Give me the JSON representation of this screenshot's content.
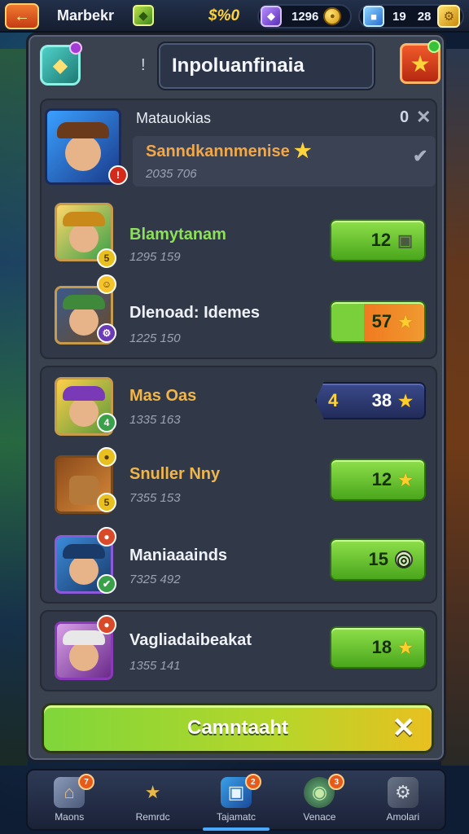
{
  "topbar": {
    "back_icon": "back-arrow-icon",
    "title": "Marbekr",
    "coins": "$%0",
    "gem_count": "1296",
    "cube_count": "19",
    "cube_count2": "28"
  },
  "panel": {
    "title": "Inpoluanfinaia",
    "separator": "!"
  },
  "featured": {
    "header": "Matauokias",
    "header_count": "0",
    "name": "Sanndkannmenise",
    "sub": "2035 706"
  },
  "list": [
    {
      "name": "Blamytanam",
      "sub": "1295 159",
      "value": "12",
      "icon": "chest-icon",
      "name_color": "#8de05a",
      "badge": "5"
    },
    {
      "name": "Dlenoad: Idemes",
      "sub": "1225 150",
      "value": "57",
      "icon": "star-icon",
      "name_color": "#eef1f6",
      "badge": ""
    },
    {
      "name": "Mas Oas",
      "sub": "1335 163",
      "value": "38",
      "icon": "star-icon",
      "name_color": "#f0b64a",
      "badge": "4",
      "prefix": "4"
    },
    {
      "name": "Snuller Nny",
      "sub": "7355 153",
      "value": "12",
      "icon": "star-icon",
      "name_color": "#f0b64a",
      "badge": "5"
    },
    {
      "name": "Maniaaainds",
      "sub": "7325 492",
      "value": "15",
      "icon": "coin-icon",
      "name_color": "#eef1f6",
      "badge": ""
    },
    {
      "name": "Vagliadaibeakat",
      "sub": "1355 141",
      "value": "18",
      "icon": "star-icon",
      "name_color": "#eef1f6",
      "badge": ""
    }
  ],
  "cta": {
    "label": "Camntaaht",
    "close_glyph": "✕"
  },
  "bottomnav": [
    {
      "label": "Maons",
      "icon": "home-icon",
      "glyph": "⌂",
      "badge": "7"
    },
    {
      "label": "Remrdc",
      "icon": "star-icon",
      "glyph": "★",
      "badge": ""
    },
    {
      "label": "Tajamatc",
      "icon": "cards-icon",
      "glyph": "▣",
      "badge": "2"
    },
    {
      "label": "Venace",
      "icon": "shield-icon",
      "glyph": "◉",
      "badge": "3"
    },
    {
      "label": "Amolari",
      "icon": "gear-icon",
      "glyph": "⚙",
      "badge": ""
    }
  ]
}
